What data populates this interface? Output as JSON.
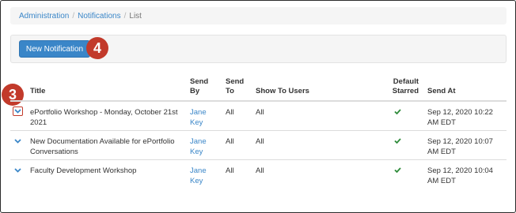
{
  "breadcrumb": {
    "items": [
      "Administration",
      "Notifications"
    ],
    "current": "List"
  },
  "toolbar": {
    "new_notification_label": "New Notification"
  },
  "callouts": {
    "badge_4": "4",
    "badge_3": "3"
  },
  "colors": {
    "primary": "#3a86c8",
    "callout": "#c23a2b",
    "check": "#2e8b3a"
  },
  "table": {
    "headers": {
      "title": "Title",
      "send_by": "Send By",
      "send_to": "Send To",
      "show_to_users": "Show To Users",
      "default_starred": "Default Starred",
      "send_at": "Send At"
    },
    "rows": [
      {
        "title": "ePortfolio Workshop - Monday, October 21st 2021",
        "send_by": "Jane Key",
        "send_to": "All",
        "show_to_users": "All",
        "default_starred": "check-icon",
        "send_at": "Sep 12, 2020 10:22 AM EDT"
      },
      {
        "title": "New Documentation Available for ePortfolio Conversations",
        "send_by": "Jane Key",
        "send_to": "All",
        "show_to_users": "All",
        "default_starred": "check-icon",
        "send_at": "Sep 12, 2020 10:07 AM EDT"
      },
      {
        "title": "Faculty Development Workshop",
        "send_by": "Jane Key",
        "send_to": "All",
        "show_to_users": "All",
        "default_starred": "check-icon",
        "send_at": "Sep 12, 2020 10:04 AM EDT"
      }
    ]
  }
}
